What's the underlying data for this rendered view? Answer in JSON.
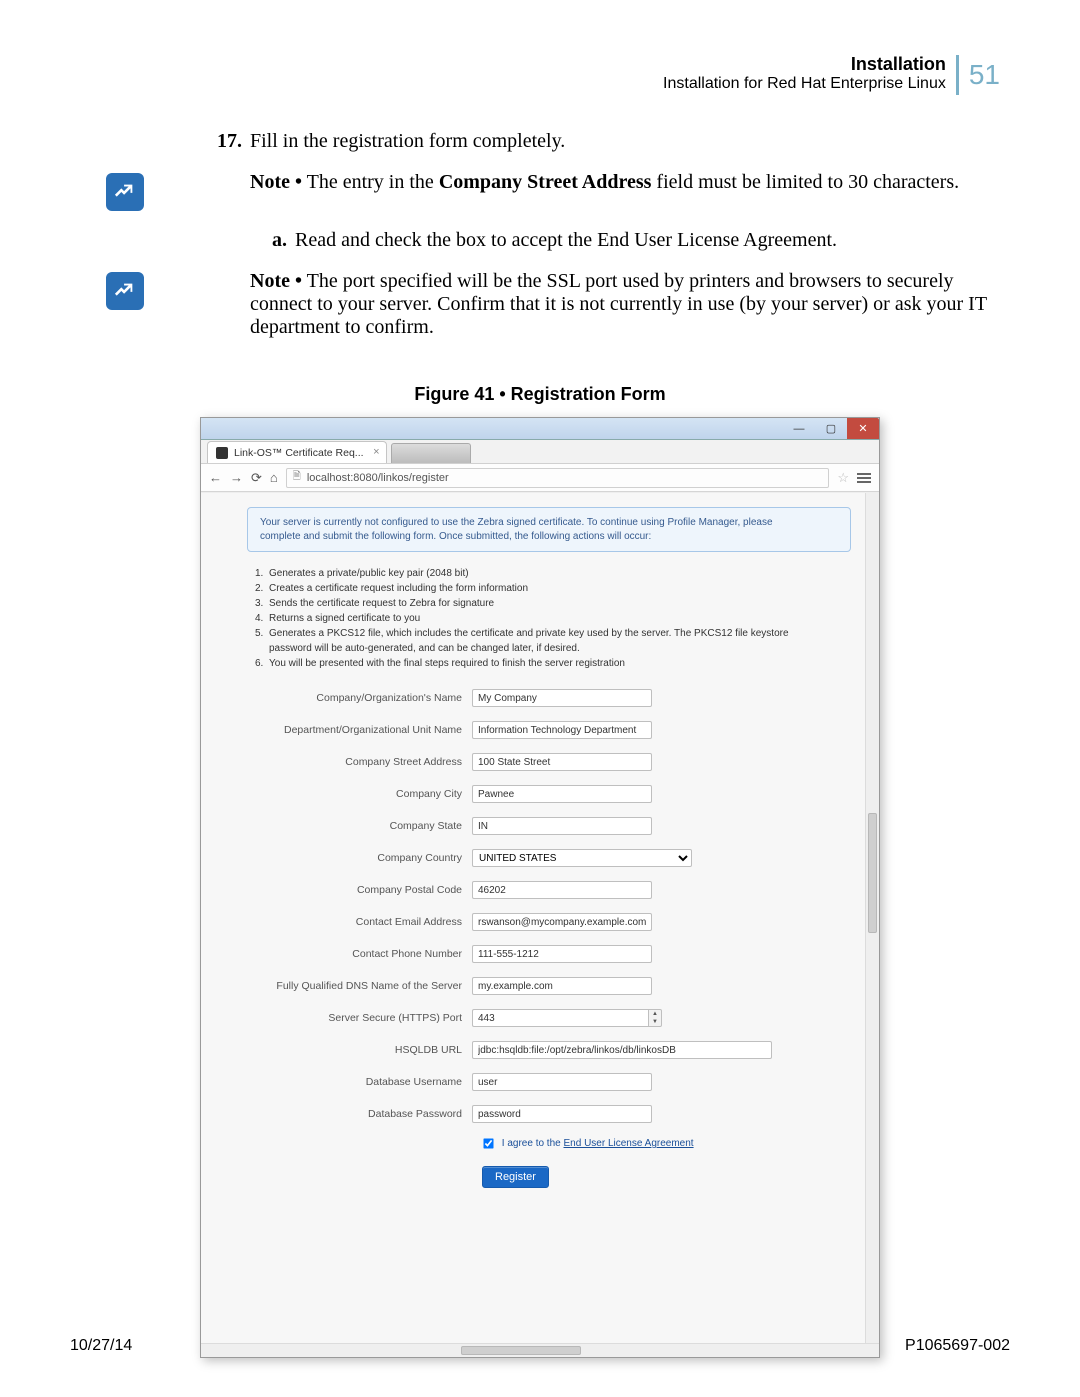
{
  "header": {
    "title": "Installation",
    "subtitle": "Installation for Red Hat Enterprise Linux",
    "page_number": "51"
  },
  "step17": {
    "num": "17.",
    "text": "Fill in the registration form completely."
  },
  "note1": {
    "label": "Note •",
    "text_a": " The entry in the ",
    "bold": "Company Street Address",
    "text_b": " field must be limited to 30 characters."
  },
  "step_a": {
    "num": "a.",
    "text": "Read and check the box to accept the End User License Agreement."
  },
  "note2": {
    "label": "Note •",
    "text": " The port specified will be the SSL port used by printers and browsers to securely connect to your server. Confirm that it is not currently in use (by your server) or ask your IT department to confirm."
  },
  "figure": {
    "caption": "Figure 41 • Registration Form"
  },
  "browser": {
    "tab_title": "Link-OS™ Certificate Req...",
    "url": "localhost:8080/linkos/register",
    "win_min": "—",
    "win_max": "▢",
    "win_close": "✕"
  },
  "notice": {
    "line1": "Your server is currently not configured to use the Zebra signed certificate. To continue using Profile Manager, please",
    "line2": "complete and submit the following form. Once submitted, the following actions will occur:"
  },
  "steps_list": {
    "s1": "Generates a private/public key pair (2048 bit)",
    "s2": "Creates a certificate request including the form information",
    "s3": "Sends the certificate request to Zebra for signature",
    "s4": "Returns a signed certificate to you",
    "s5a": "Generates a PKCS12 file, which includes the certificate and private key used by the server. The PKCS12 file keystore",
    "s5b": "password will be auto-generated, and can be changed later, if desired.",
    "s6": "You will be presented with the final steps required to finish the server registration"
  },
  "form": {
    "org_name": {
      "label": "Company/Organization's Name",
      "value": "My Company"
    },
    "dept": {
      "label": "Department/Organizational Unit Name",
      "value": "Information Technology Department"
    },
    "street": {
      "label": "Company Street Address",
      "value": "100 State Street"
    },
    "city": {
      "label": "Company City",
      "value": "Pawnee"
    },
    "state": {
      "label": "Company State",
      "value": "IN"
    },
    "country": {
      "label": "Company Country",
      "value": "UNITED STATES"
    },
    "postal": {
      "label": "Company Postal Code",
      "value": "46202"
    },
    "email": {
      "label": "Contact Email Address",
      "value": "rswanson@mycompany.example.com"
    },
    "phone": {
      "label": "Contact Phone Number",
      "value": "111-555-1212"
    },
    "fqdn": {
      "label": "Fully Qualified DNS Name of the Server",
      "value": "my.example.com"
    },
    "port": {
      "label": "Server Secure (HTTPS) Port",
      "value": "443"
    },
    "hsqldb": {
      "label": "HSQLDB URL",
      "value": "jdbc:hsqldb:file:/opt/zebra/linkos/db/linkosDB"
    },
    "db_user": {
      "label": "Database Username",
      "value": "user"
    },
    "db_pass": {
      "label": "Database Password",
      "value": "password"
    },
    "eula_text": "I agree to the ",
    "eula_link": "End User License Agreement",
    "register": "Register"
  },
  "footer": {
    "date": "10/27/14",
    "doc": "P1065697-002"
  }
}
